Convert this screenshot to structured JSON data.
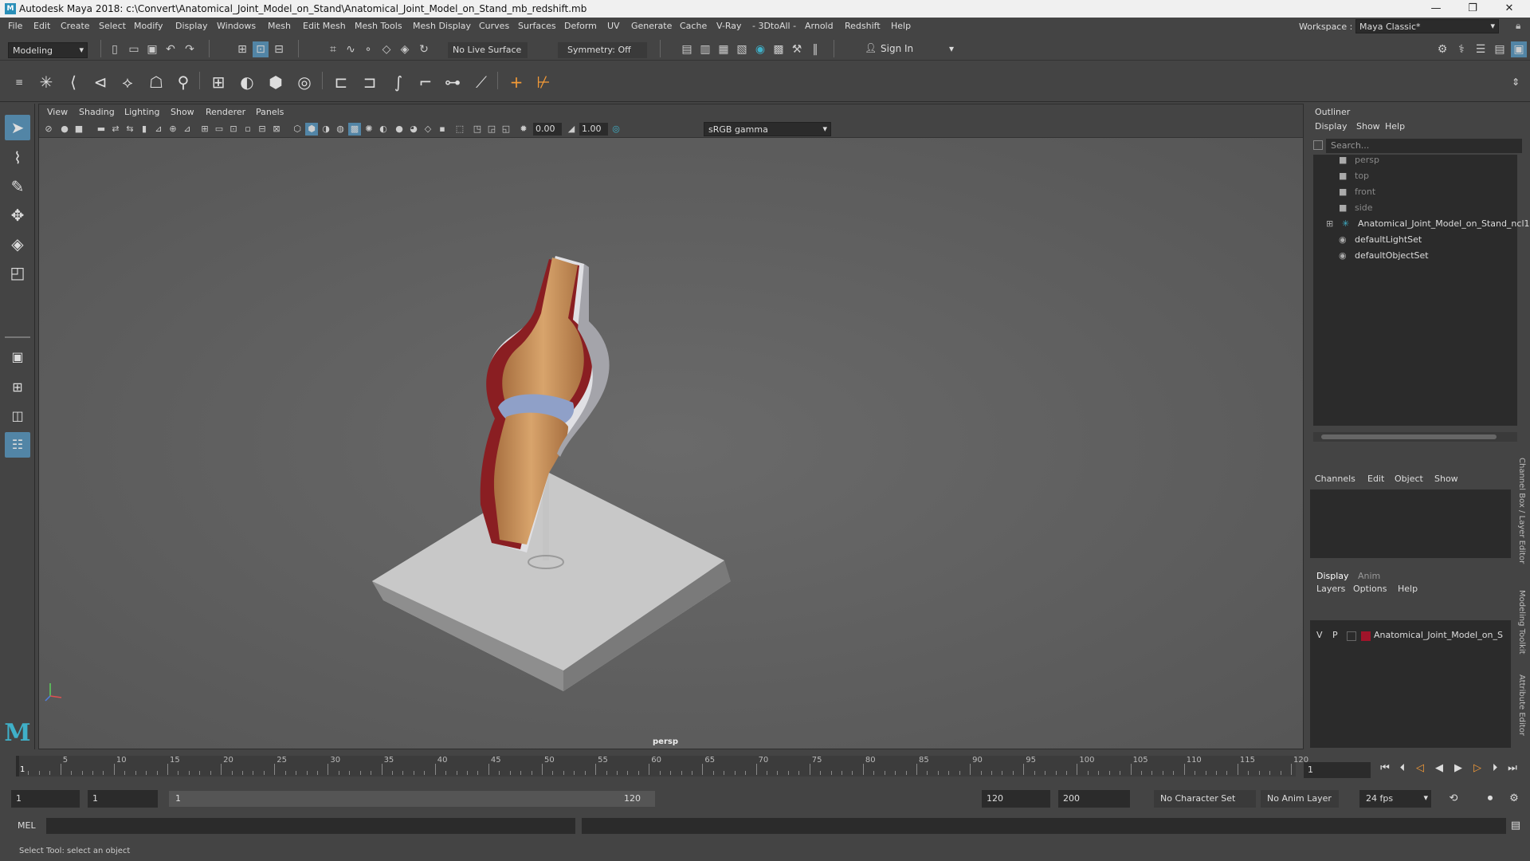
{
  "window": {
    "title": "Autodesk Maya 2018: c:\\Convert\\Anatomical_Joint_Model_on_Stand\\Anatomical_Joint_Model_on_Stand_mb_redshift.mb",
    "minimize": "—",
    "maximize": "❐",
    "close": "✕"
  },
  "menu": [
    "File",
    "Edit",
    "Create",
    "Select",
    "Modify",
    "Display",
    "Windows",
    "Mesh",
    "Edit Mesh",
    "Mesh Tools",
    "Mesh Display",
    "Curves",
    "Surfaces",
    "Deform",
    "UV",
    "Generate",
    "Cache",
    "V-Ray",
    "- 3DtoAll -",
    "Arnold",
    "Redshift",
    "Help"
  ],
  "workspace": {
    "label": "Workspace :",
    "value": "Maya Classic*"
  },
  "statusline": {
    "mode": "Modeling",
    "live_surface": "No Live Surface",
    "symmetry": "Symmetry: Off",
    "sign_in": "Sign In"
  },
  "viewport": {
    "menu": [
      "View",
      "Shading",
      "Lighting",
      "Show",
      "Renderer",
      "Panels"
    ],
    "exposure": "0.00",
    "gamma_value": "1.00",
    "color_space": "sRGB gamma",
    "camera": "persp"
  },
  "outliner": {
    "title": "Outliner",
    "menu": [
      "Display",
      "Show",
      "Help"
    ],
    "search_placeholder": "Search...",
    "items": [
      {
        "label": "persp",
        "icon": "camera-icon",
        "dim": true
      },
      {
        "label": "top",
        "icon": "camera-icon",
        "dim": true
      },
      {
        "label": "front",
        "icon": "camera-icon",
        "dim": true
      },
      {
        "label": "side",
        "icon": "camera-icon",
        "dim": true
      },
      {
        "label": "Anatomical_Joint_Model_on_Stand_ncl1",
        "icon": "group-icon",
        "dim": false
      },
      {
        "label": "defaultLightSet",
        "icon": "set-icon",
        "dim": false
      },
      {
        "label": "defaultObjectSet",
        "icon": "set-icon",
        "dim": false
      }
    ]
  },
  "channelbox": {
    "menu": [
      "Channels",
      "Edit",
      "Object",
      "Show"
    ]
  },
  "layers": {
    "tabs": [
      "Display",
      "Anim"
    ],
    "menu": [
      "Layers",
      "Options",
      "Help"
    ],
    "row": {
      "v": "V",
      "p": "P",
      "name": "Anatomical_Joint_Model_on_S",
      "color": "#a0142a"
    }
  },
  "side_tabs": [
    "Channel Box / Layer Editor",
    "Modeling Toolkit",
    "Attribute Editor"
  ],
  "timeline": {
    "ticks": [
      1,
      5,
      10,
      15,
      20,
      25,
      30,
      35,
      40,
      45,
      50,
      55,
      60,
      65,
      70,
      75,
      80,
      85,
      90,
      95,
      100,
      105,
      110,
      115,
      120
    ],
    "current_frame": "1"
  },
  "range": {
    "start": "1",
    "playback_start": "1",
    "bar_start": "1",
    "bar_end": "120",
    "playback_end": "120",
    "end": "200",
    "character_set": "No Character Set",
    "anim_layer": "No Anim Layer",
    "fps": "24 fps"
  },
  "cmdline": {
    "label": "MEL"
  },
  "helpline": {
    "text": "Select Tool: select an object"
  },
  "colors": {
    "accent": "#5285a6",
    "bone": "#c49060",
    "tissue": "#8a1e22",
    "cartilage": "#8fa0c8",
    "stand": "#bdbdbd"
  }
}
